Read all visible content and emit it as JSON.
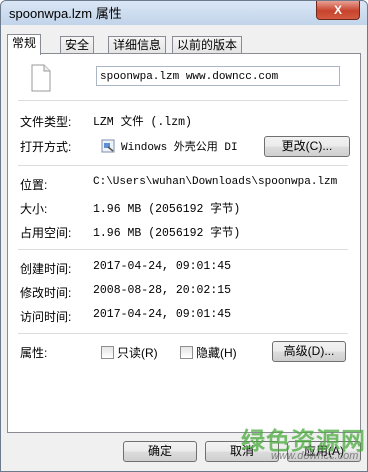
{
  "window": {
    "title": "spoonwpa.lzm 属性",
    "close_label": "X"
  },
  "tabs": [
    {
      "label": "常规",
      "active": true
    },
    {
      "label": "安全",
      "active": false
    },
    {
      "label": "详细信息",
      "active": false
    },
    {
      "label": "以前的版本",
      "active": false
    }
  ],
  "general": {
    "file_name": "spoonwpa.lzm  www.downcc.com",
    "file_type_label": "文件类型:",
    "file_type_value": "LZM 文件 (.lzm)",
    "open_with_label": "打开方式:",
    "open_with_value": "Windows 外壳公用 DI",
    "change_button": "更改(C)...",
    "location_label": "位置:",
    "location_value": "C:\\Users\\wuhan\\Downloads\\spoonwpa.lzm",
    "size_label": "大小:",
    "size_value": "1.96 MB (2056192 字节)",
    "size_on_disk_label": "占用空间:",
    "size_on_disk_value": "1.96 MB (2056192 字节)",
    "created_label": "创建时间:",
    "created_value": "2017-04-24, 09:01:45",
    "modified_label": "修改时间:",
    "modified_value": "2008-08-28, 20:02:15",
    "accessed_label": "访问时间:",
    "accessed_value": "2017-04-24, 09:01:45",
    "attributes_label": "属性:",
    "readonly_label": "只读(R)",
    "readonly_checked": false,
    "hidden_label": "隐藏(H)",
    "hidden_checked": false,
    "advanced_button": "高级(D)..."
  },
  "footer": {
    "ok_button": "确定",
    "cancel_button": "取消",
    "apply_button": "应用(A)"
  },
  "watermark": {
    "text": "绿色资源网",
    "url": "www.downcc.com"
  },
  "colors": {
    "titlebar": "#c2d4ea",
    "close_button": "#c7432c",
    "dialog_background": "#f0f0f0",
    "watermark": "#48aa3c"
  }
}
